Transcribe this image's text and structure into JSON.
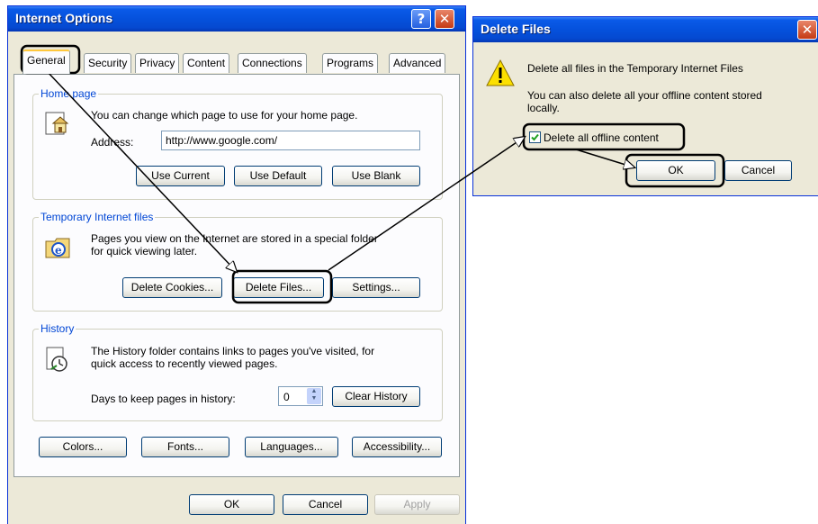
{
  "internet_options": {
    "title": "Internet Options",
    "help_label": "?",
    "close_label": "✕",
    "tabs": [
      {
        "label": "General"
      },
      {
        "label": "Security"
      },
      {
        "label": "Privacy"
      },
      {
        "label": "Content"
      },
      {
        "label": "Connections"
      },
      {
        "label": "Programs"
      },
      {
        "label": "Advanced"
      }
    ],
    "home_page": {
      "legend": "Home page",
      "description": "You can change which page to use for your home page.",
      "address_label": "Address:",
      "address_value": "http://www.google.com/",
      "use_current": "Use Current",
      "use_default": "Use Default",
      "use_blank": "Use Blank"
    },
    "temp_files": {
      "legend": "Temporary Internet files",
      "description_line1": "Pages you view on the Internet are stored in a special folder",
      "description_line2": "for quick viewing later.",
      "delete_cookies": "Delete Cookies...",
      "delete_files": "Delete Files...",
      "settings": "Settings..."
    },
    "history": {
      "legend": "History",
      "description_line1": "The History folder contains links to pages you've visited, for",
      "description_line2": "quick access to recently viewed pages.",
      "days_label": "Days to keep pages in history:",
      "days_value": "0",
      "clear_history": "Clear History"
    },
    "bottom_buttons": {
      "colors": "Colors...",
      "fonts": "Fonts...",
      "languages": "Languages...",
      "accessibility": "Accessibility..."
    },
    "dialog_buttons": {
      "ok": "OK",
      "cancel": "Cancel",
      "apply": "Apply"
    }
  },
  "delete_files": {
    "title": "Delete Files",
    "close_label": "✕",
    "message_line1": "Delete all files in the Temporary Internet Files",
    "message_line2": "You can also delete all your offline content stored",
    "message_line3": "locally.",
    "checkbox_label": "Delete all offline content",
    "checkbox_checked": true,
    "ok": "OK",
    "cancel": "Cancel"
  },
  "colors": {
    "titlebar": "#0551dc",
    "dialog_face": "#ece9d8",
    "group_legend": "#0046d5",
    "annotation": "#000000"
  }
}
